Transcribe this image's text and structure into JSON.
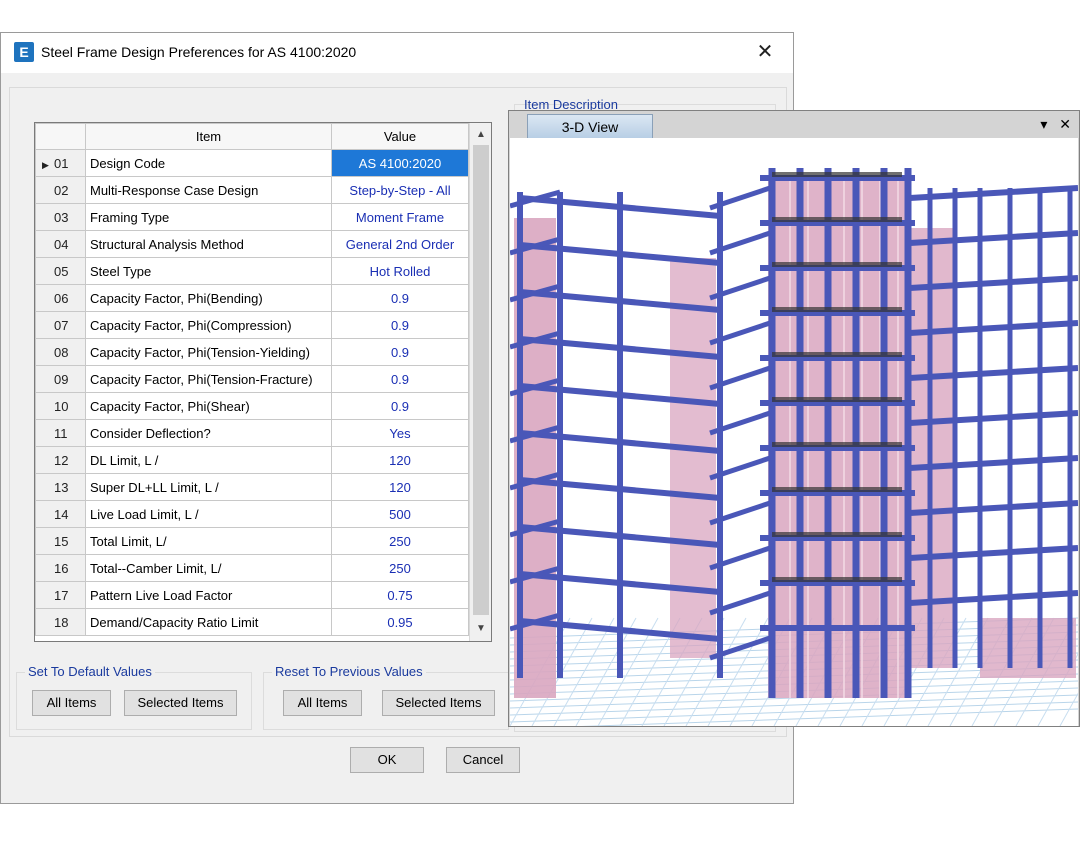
{
  "dialog": {
    "title": "Steel Frame Design Preferences for AS 4100:2020",
    "icon": "E",
    "close_glyph": "✕"
  },
  "grid": {
    "columns": {
      "item": "Item",
      "value": "Value"
    },
    "rows": [
      {
        "num": "01",
        "item": "Design Code",
        "value": "AS 4100:2020"
      },
      {
        "num": "02",
        "item": "Multi-Response Case Design",
        "value": "Step-by-Step - All"
      },
      {
        "num": "03",
        "item": "Framing Type",
        "value": "Moment Frame"
      },
      {
        "num": "04",
        "item": "Structural Analysis Method",
        "value": "General 2nd Order"
      },
      {
        "num": "05",
        "item": "Steel Type",
        "value": "Hot Rolled"
      },
      {
        "num": "06",
        "item": "Capacity Factor, Phi(Bending)",
        "value": "0.9"
      },
      {
        "num": "07",
        "item": "Capacity Factor, Phi(Compression)",
        "value": "0.9"
      },
      {
        "num": "08",
        "item": "Capacity Factor, Phi(Tension-Yielding)",
        "value": "0.9"
      },
      {
        "num": "09",
        "item": "Capacity Factor, Phi(Tension-Fracture)",
        "value": "0.9"
      },
      {
        "num": "10",
        "item": "Capacity Factor, Phi(Shear)",
        "value": "0.9"
      },
      {
        "num": "11",
        "item": "Consider Deflection?",
        "value": "Yes"
      },
      {
        "num": "12",
        "item": "DL Limit, L /",
        "value": "120"
      },
      {
        "num": "13",
        "item": "Super DL+LL Limit, L /",
        "value": "120"
      },
      {
        "num": "14",
        "item": "Live Load Limit, L /",
        "value": "500"
      },
      {
        "num": "15",
        "item": "Total Limit, L/",
        "value": "250"
      },
      {
        "num": "16",
        "item": "Total--Camber Limit, L/",
        "value": "250"
      },
      {
        "num": "17",
        "item": "Pattern Live Load Factor",
        "value": "0.75"
      },
      {
        "num": "18",
        "item": "Demand/Capacity Ratio Limit",
        "value": "0.95"
      }
    ],
    "selected_index": 0
  },
  "defaults_group": {
    "legend": "Set To Default Values",
    "all_items": "All Items",
    "selected_items": "Selected Items"
  },
  "reset_group": {
    "legend": "Reset To Previous Values",
    "all_items": "All Items",
    "selected_items": "Selected Items"
  },
  "footer": {
    "ok": "OK",
    "cancel": "Cancel"
  },
  "description": {
    "label": "Item Description"
  },
  "view3d": {
    "tab": "3-D View",
    "dropdown_glyph": "▾",
    "close_glyph": "✕"
  },
  "colors": {
    "frame": "#4a57b8",
    "wall": "#d9a6c0",
    "selected": "#1e78d7",
    "value_text": "#1a2fb4"
  }
}
